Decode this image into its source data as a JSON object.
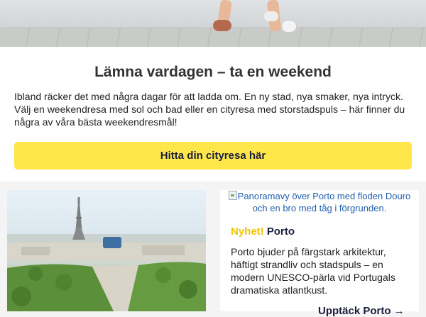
{
  "email": {
    "headline": "Lämna vardagen – ta en weekend",
    "intro": "Ibland räcker det med några dagar för att ladda om. En ny stad, nya smaker, nya intryck. Välj en weekendresa med sol och bad eller en cityresa med storstadspuls – här finner du några av våra bästa weekendresmål!",
    "cta_label": "Hitta din cityresa här"
  },
  "cards": {
    "porto": {
      "image_alt": "Panoramavy över Porto med floden Douro och en bro med tåg i förgrunden.",
      "badge": "Nyhet!",
      "title": "Porto",
      "description": "Porto bjuder på färgstark arkitektur, häftigt strandliv och stadspuls – en modern UNESCO-pärla vid Portugals dramatiska atlantkust.",
      "link_label": "Upptäck Porto →"
    }
  },
  "colors": {
    "accent_yellow": "#ffe74a",
    "badge_yellow": "#f2c500",
    "navy": "#1b1f3b",
    "link_blue": "#1f5fb0"
  }
}
